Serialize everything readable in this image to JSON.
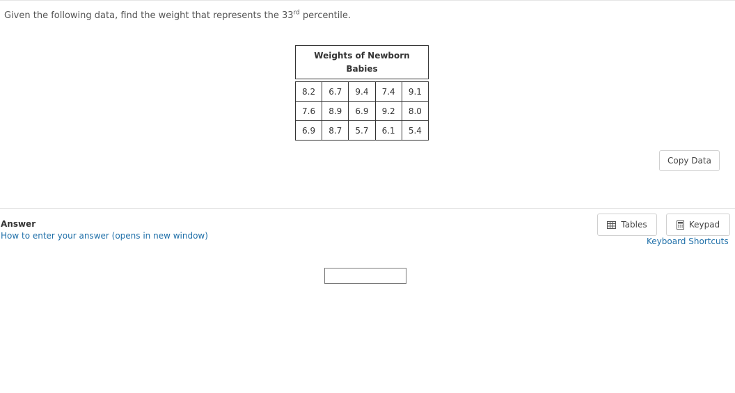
{
  "question": {
    "text_before": "Given the following data, find the weight that represents the 33",
    "superscript": "rd",
    "text_after": " percentile."
  },
  "table": {
    "caption_line1": "Weights of Newborn",
    "caption_line2": "Babies",
    "rows": [
      [
        "8.2",
        "6.7",
        "9.4",
        "7.4",
        "9.1"
      ],
      [
        "7.6",
        "8.9",
        "6.9",
        "9.2",
        "8.0"
      ],
      [
        "6.9",
        "8.7",
        "5.7",
        "6.1",
        "5.4"
      ]
    ]
  },
  "copy_data_label": "Copy Data",
  "answer": {
    "heading": "Answer",
    "help_link": "How to enter your answer (opens in new window)",
    "input_value": ""
  },
  "tools": {
    "tables_label": "Tables",
    "keypad_label": "Keypad",
    "tables_icon": "table-grid-icon",
    "keypad_icon": "calculator-icon",
    "shortcuts_link": "Keyboard Shortcuts"
  },
  "colors": {
    "link": "#1d6ea8",
    "text": "#333333",
    "border": "#d0d0d0"
  }
}
